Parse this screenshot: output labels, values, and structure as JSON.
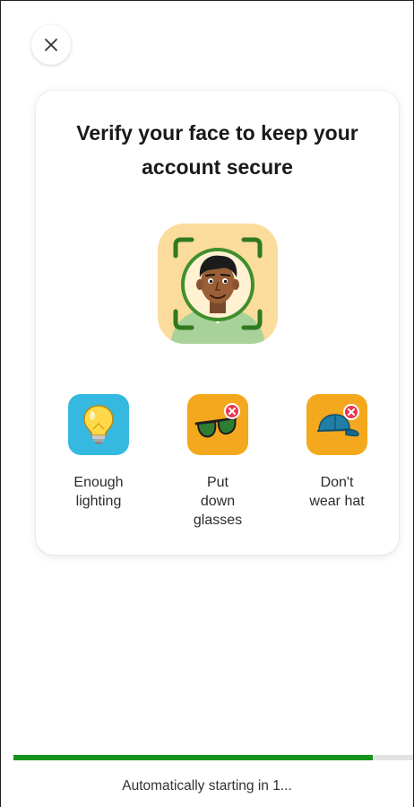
{
  "header": {
    "close_icon": "close-icon"
  },
  "card": {
    "title": "Verify your face to keep your account secure",
    "illustration_icon": "face-scan-icon",
    "tips": [
      {
        "icon": "lightbulb-icon",
        "label": "Enough\nlighting",
        "color": "#35b9e0"
      },
      {
        "icon": "sunglasses-crossed-icon",
        "label": "Put\ndown\nglasses",
        "color": "#f4a81d"
      },
      {
        "icon": "cap-crossed-icon",
        "label": "Don't\nwear hat",
        "color": "#f4a81d"
      }
    ]
  },
  "footer": {
    "progress": 0.9,
    "status": "Automatically starting in 1..."
  },
  "colors": {
    "progress_fill": "#12941b",
    "face_frame": "#2f7a1f",
    "face_tile": "#fbdc9c",
    "cross_badge": "#e8384f"
  }
}
